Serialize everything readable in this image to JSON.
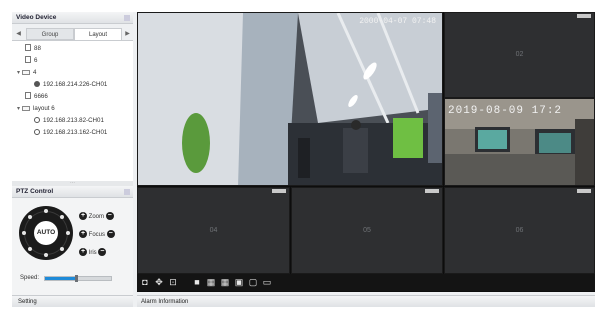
{
  "left_panel": {
    "title": "Video Device",
    "tabs": [
      "Group",
      "Layout"
    ],
    "tree": [
      {
        "label": "88",
        "type": "doc"
      },
      {
        "label": "6",
        "type": "doc"
      },
      {
        "label": "4",
        "type": "folder"
      },
      {
        "label": "192.168.214.226-CH01",
        "type": "camera"
      },
      {
        "label": "6666",
        "type": "doc"
      },
      {
        "label": "layout 6",
        "type": "folder"
      },
      {
        "label": "192.168.213.82-CH01",
        "type": "clock"
      },
      {
        "label": "192.168.213.162-CH01",
        "type": "clock"
      }
    ]
  },
  "ptz": {
    "title": "PTZ Control",
    "auto_label": "AUTO",
    "zoom_label": "Zoom",
    "focus_label": "Focus",
    "iris_label": "Iris",
    "plus": "+",
    "minus": "−",
    "speed_label": "Speed:",
    "speed_fraction": 0.45
  },
  "setting_label": "Setting",
  "alarm_label": "Alarm Information",
  "video": {
    "main_osd": "2000-04-07 07:48",
    "second_osd": "2019-08-09 17:2",
    "cells": [
      "02",
      "04",
      "05",
      "06"
    ]
  },
  "toolbar_icons": [
    "camera-icon",
    "ptz-icon",
    "record-icon",
    "layout-1-icon",
    "layout-4-icon",
    "layout-9-icon",
    "layout-16-icon",
    "layout-custom-icon",
    "fullscreen-icon"
  ],
  "colors": {
    "speed_fill": "#1e8ad8",
    "video_bg": "#2e2f31",
    "toolbar_bg": "#141414"
  }
}
